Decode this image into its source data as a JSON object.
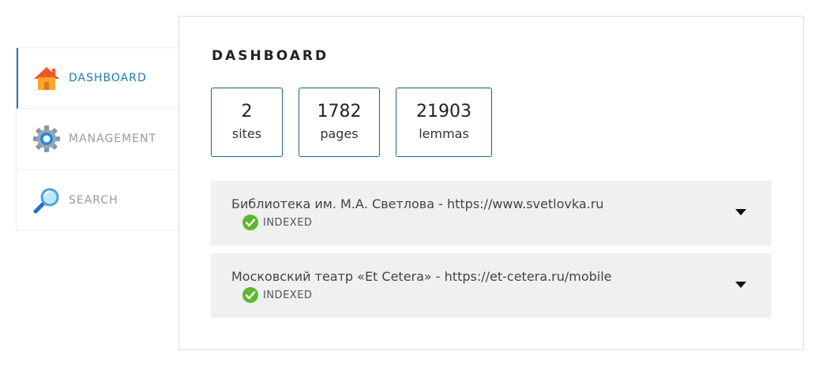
{
  "sidebar": {
    "items": [
      {
        "label": "DASHBOARD",
        "icon": "home-icon",
        "active": true
      },
      {
        "label": "MANAGEMENT",
        "icon": "gear-icon",
        "active": false
      },
      {
        "label": "SEARCH",
        "icon": "magnifier-icon",
        "active": false
      }
    ]
  },
  "main": {
    "title": "DASHBOARD",
    "stats": [
      {
        "value": "2",
        "label": "sites"
      },
      {
        "value": "1782",
        "label": "pages"
      },
      {
        "value": "21903",
        "label": "lemmas"
      }
    ],
    "sites": [
      {
        "name": "Библиотека им. М.А. Светлова - https://www.svetlovka.ru",
        "status": "INDEXED"
      },
      {
        "name": "Московский театр «Et Cetera» - https://et-cetera.ru/mobile",
        "status": "INDEXED"
      }
    ]
  },
  "colors": {
    "accent": "#1f78b4",
    "stat_border": "#1f5f8a",
    "status_ok": "#5cb82e",
    "site_bg": "#f0f0f0"
  }
}
